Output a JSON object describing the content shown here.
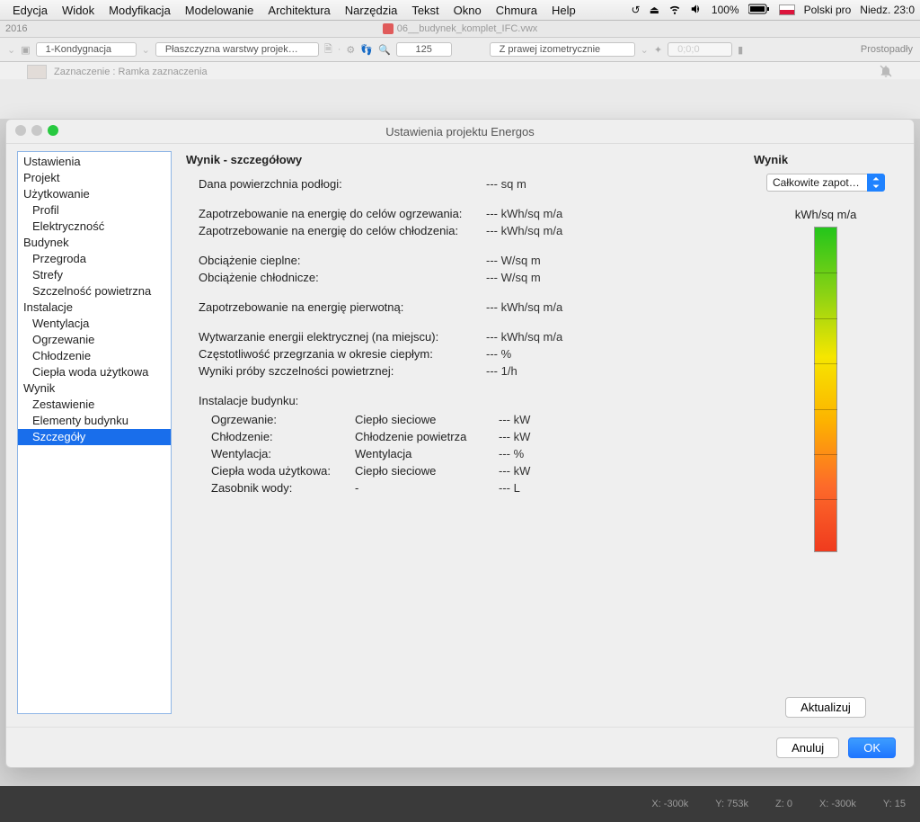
{
  "menubar": {
    "items": [
      "Edycja",
      "Widok",
      "Modyfikacja",
      "Modelowanie",
      "Architektura",
      "Narzędzia",
      "Tekst",
      "Okno",
      "Chmura",
      "Help"
    ],
    "battery": "100%",
    "lang_label": "Polski pro",
    "clock": "Niedz. 23:0"
  },
  "titlebar": {
    "app_year": "2016",
    "doc": "06__budynek_komplet_IFC.vwx"
  },
  "toolbar": {
    "layer": "1-Kondygnacja",
    "plane": "Płaszczyzna warstwy projek…",
    "zoom": "125",
    "view": "Z prawej izometrycznie",
    "mode": "Prostopadły"
  },
  "breadcrumb": {
    "text": "Zaznaczenie : Ramka zaznaczenia"
  },
  "dialog": {
    "title": "Ustawienia projektu Energos",
    "sidebar": [
      {
        "label": "Ustawienia",
        "indent": 0
      },
      {
        "label": "Projekt",
        "indent": 0
      },
      {
        "label": "Użytkowanie",
        "indent": 0
      },
      {
        "label": "Profil",
        "indent": 1
      },
      {
        "label": "Elektryczność",
        "indent": 1
      },
      {
        "label": "Budynek",
        "indent": 0
      },
      {
        "label": "Przegroda",
        "indent": 1
      },
      {
        "label": "Strefy",
        "indent": 1
      },
      {
        "label": "Szczelność powietrzna",
        "indent": 1
      },
      {
        "label": "Instalacje",
        "indent": 0
      },
      {
        "label": "Wentylacja",
        "indent": 1
      },
      {
        "label": "Ogrzewanie",
        "indent": 1
      },
      {
        "label": "Chłodzenie",
        "indent": 1
      },
      {
        "label": "Ciepła woda użytkowa",
        "indent": 1
      },
      {
        "label": "Wynik",
        "indent": 0
      },
      {
        "label": "Zestawienie",
        "indent": 1
      },
      {
        "label": "Elementy budynku",
        "indent": 1
      },
      {
        "label": "Szczegóły",
        "indent": 1,
        "selected": true
      }
    ],
    "detail_title": "Wynik - szczegółowy",
    "rows_a": [
      {
        "label": "Dana powierzchnia podłogi:",
        "value": "--- sq m"
      }
    ],
    "rows_b": [
      {
        "label": "Zapotrzebowanie na energię do celów ogrzewania:",
        "value": "--- kWh/sq m/a"
      },
      {
        "label": "Zapotrzebowanie na energię do celów chłodzenia:",
        "value": "--- kWh/sq m/a"
      }
    ],
    "rows_c": [
      {
        "label": "Obciążenie cieplne:",
        "value": "--- W/sq m"
      },
      {
        "label": "Obciążenie chłodnicze:",
        "value": "--- W/sq m"
      }
    ],
    "rows_d": [
      {
        "label": "Zapotrzebowanie na energię pierwotną:",
        "value": "--- kWh/sq m/a"
      }
    ],
    "rows_e": [
      {
        "label": "Wytwarzanie energii elektrycznej (na miejscu):",
        "value": "--- kWh/sq m/a"
      },
      {
        "label": "Częstotliwość przegrzania w okresie ciepłym:",
        "value": "--- %"
      },
      {
        "label": "Wyniki próby szczelności powietrznej:",
        "value": "--- 1/h"
      }
    ],
    "install_title": "Instalacje budynku:",
    "install_rows": [
      {
        "label": "Ogrzewanie:",
        "type": "Ciepło sieciowe",
        "value": "--- kW"
      },
      {
        "label": "Chłodzenie:",
        "type": "Chłodzenie powietrza",
        "value": "--- kW"
      },
      {
        "label": "Wentylacja:",
        "type": "Wentylacja",
        "value": "--- %"
      },
      {
        "label": "Ciepła woda użytkowa:",
        "type": "Ciepło sieciowe",
        "value": "--- kW"
      },
      {
        "label": "Zasobnik wody:",
        "type": "-",
        "value": "--- L"
      }
    ],
    "right": {
      "title": "Wynik",
      "combo": "Całkowite zapotr…",
      "unit": "kWh/sq m/a",
      "update": "Aktualizuj"
    },
    "buttons": {
      "cancel": "Anuluj",
      "ok": "OK"
    }
  },
  "statusbar": {
    "x": "X: -300k",
    "y": "Y: 753k",
    "z": "Z: 0",
    "x2": "X: -300k",
    "y2": "Y: 15"
  }
}
